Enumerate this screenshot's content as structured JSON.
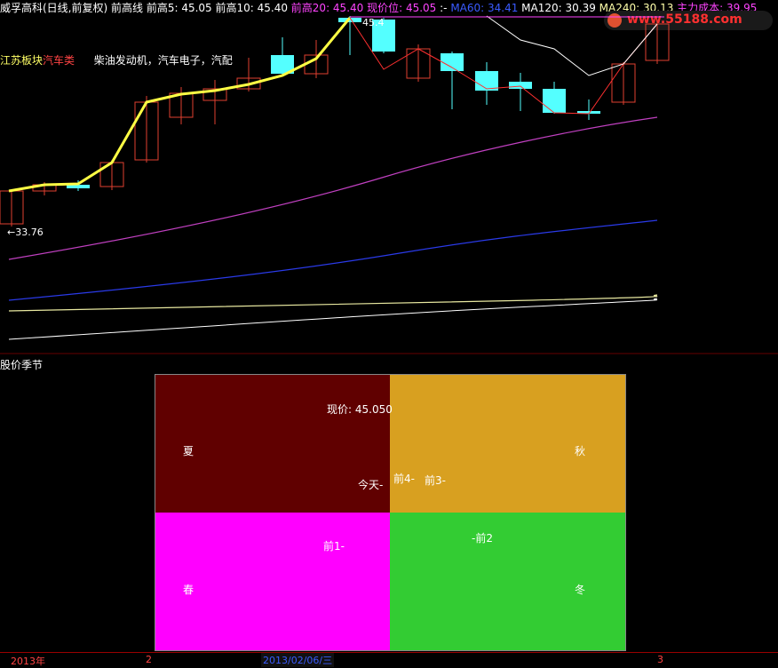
{
  "header": {
    "stock_name": "威孚高科(日线,前复权) 前高线",
    "items": [
      {
        "text": "前高5: 45.05",
        "color": "#ffffff"
      },
      {
        "text": "前高10: 45.40",
        "color": "#ffffff"
      },
      {
        "text": "前高20: 45.40",
        "color": "#ff44ff"
      },
      {
        "text": "现价位: 45.05",
        "color": "#ff44ff"
      },
      {
        "text": ":-",
        "color": "#ffffff"
      },
      {
        "text": "MA60: 34.41",
        "color": "#3a5bff"
      },
      {
        "text": "MA120: 30.39",
        "color": "#ffffff"
      },
      {
        "text": "MA240: 30.13",
        "color": "#ffffaa"
      },
      {
        "text": "主力成本: 39.95",
        "color": "#ff44ff"
      }
    ]
  },
  "watermark": "www.55188.com",
  "sector": {
    "prefix": "江苏板块",
    "category": "汽车类",
    "concepts": "柴油发动机，汽车电子，汽配"
  },
  "price_marks": {
    "low_label": "←33.76",
    "high_label": "45.4"
  },
  "subpanel_title": "股价季节",
  "seasons": {
    "summer": "夏",
    "autumn": "秋",
    "spring": "春",
    "winter": "冬",
    "current_price": "现价: 45.050",
    "today": "今天-",
    "prev1": "前1-",
    "prev2": "-前2",
    "prev3": "前3-",
    "prev4": "前4-"
  },
  "colors": {
    "summer": "#600000",
    "autumn": "#d8a020",
    "spring": "#ff00ff",
    "winter": "#33cc33",
    "up_candle": "#e04030",
    "down_candle": "#54ffff",
    "ma5": "#ffff44"
  },
  "x_axis": {
    "label_year": "2013年",
    "label_2": "2",
    "cursor_date": "2013/02/06/三",
    "label_3": "3"
  }
}
